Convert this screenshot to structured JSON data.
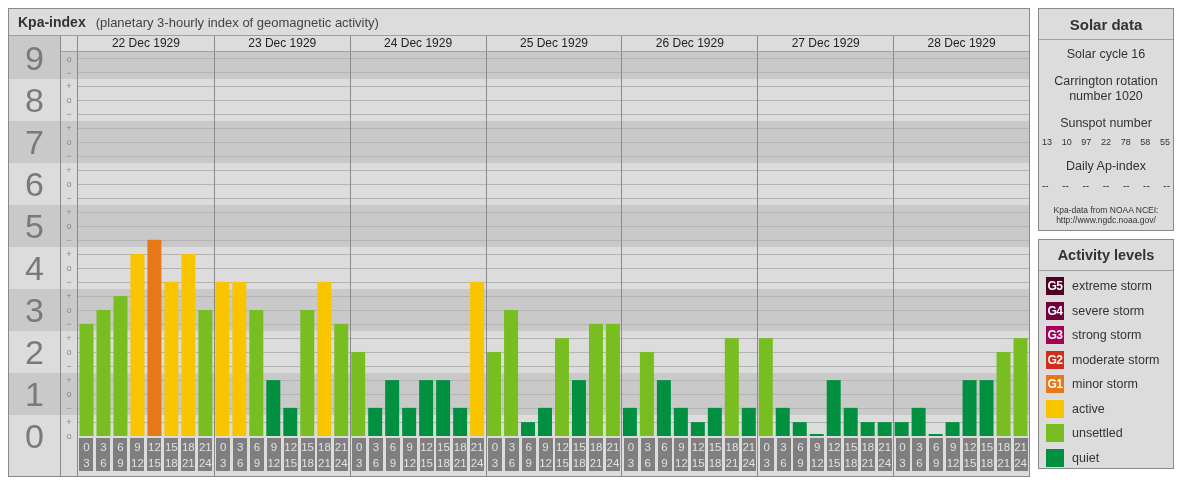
{
  "kp_chart": {
    "title": "Kpa-index",
    "subtitle": "(planetary 3-hourly index of geomagnetic activity)",
    "dates": [
      "22 Dec 1929",
      "23 Dec 1929",
      "24 Dec 1929",
      "25 Dec 1929",
      "26 Dec 1929",
      "27 Dec 1929",
      "28 Dec 1929"
    ],
    "minor_ticks": [
      "o",
      "−",
      "+",
      "o",
      "−",
      "+",
      "o",
      "−",
      "+",
      "o",
      "−",
      "+",
      "o",
      "−",
      "+",
      "o",
      "−",
      "+",
      "o",
      "−",
      "+",
      "o",
      "−",
      "+",
      "o",
      "−",
      "+",
      "o"
    ],
    "chart_data": {
      "type": "bar",
      "grid": true,
      "categories": [
        "0 3",
        "3 6",
        "6 9",
        "9 12",
        "12 15",
        "15 18",
        "18 21",
        "21 24",
        "0 3",
        "3 6",
        "6 9",
        "9 12",
        "12 15",
        "15 18",
        "18 21",
        "21 24",
        "0 3",
        "3 6",
        "6 9",
        "9 12",
        "12 15",
        "15 18",
        "18 21",
        "21 24",
        "0 3",
        "3 6",
        "6 9",
        "9 12",
        "12 15",
        "15 18",
        "18 21",
        "21 24",
        "0 3",
        "3 6",
        "6 9",
        "9 12",
        "12 15",
        "15 18",
        "18 21",
        "21 24",
        "0 3",
        "3 6",
        "6 9",
        "9 12",
        "12 15",
        "15 18",
        "18 21",
        "21 24",
        "0 3",
        "3 6",
        "6 9",
        "9 12",
        "12 15",
        "15 18",
        "18 21",
        "21 24"
      ],
      "ylim": [
        0,
        9.14
      ],
      "yticks": [
        0,
        1,
        2,
        3,
        4,
        5,
        6,
        7,
        8,
        9
      ],
      "series": [
        {
          "color": "#009040",
          "values": [
            null,
            null,
            null,
            null,
            null,
            null,
            null,
            null,
            null,
            null,
            null,
            1.33,
            0.67,
            null,
            null,
            null,
            null,
            0.67,
            1.33,
            0.67,
            1.33,
            1.33,
            0.67,
            null,
            null,
            null,
            0.33,
            0.67,
            null,
            1.33,
            null,
            null,
            0.67,
            null,
            1.33,
            0.67,
            0.33,
            0.67,
            null,
            0.67,
            null,
            0.67,
            0.33,
            0,
            1.33,
            0.67,
            0.33,
            0.33,
            0.33,
            0.67,
            0,
            0.33,
            1.33,
            1.33,
            null,
            null
          ]
        },
        {
          "color": "#78be21",
          "values": [
            2.67,
            3,
            3.33,
            null,
            null,
            null,
            null,
            3,
            null,
            null,
            3,
            null,
            null,
            3,
            null,
            2.67,
            2,
            null,
            null,
            null,
            null,
            null,
            null,
            null,
            2,
            3,
            null,
            null,
            2.33,
            null,
            2.67,
            2.67,
            null,
            2,
            null,
            null,
            null,
            null,
            2.33,
            null,
            2.33,
            null,
            null,
            null,
            null,
            null,
            null,
            null,
            null,
            null,
            null,
            null,
            null,
            null,
            2,
            2.33
          ]
        },
        {
          "color": "#f9c500",
          "values": [
            null,
            null,
            null,
            4.33,
            null,
            3.67,
            4.33,
            null,
            3.67,
            3.67,
            null,
            null,
            null,
            null,
            3.67,
            null,
            null,
            null,
            null,
            null,
            null,
            null,
            null,
            3.67,
            null,
            null,
            null,
            null,
            null,
            null,
            null,
            null,
            null,
            null,
            null,
            null,
            null,
            null,
            null,
            null,
            null,
            null,
            null,
            null,
            null,
            null,
            null,
            null,
            null,
            null,
            null,
            null,
            null,
            null,
            null,
            null
          ]
        },
        {
          "color": "#e67817",
          "values": [
            null,
            null,
            null,
            null,
            4.67,
            null,
            null,
            null,
            null,
            null,
            null,
            null,
            null,
            null,
            null,
            null,
            null,
            null,
            null,
            null,
            null,
            null,
            null,
            null,
            null,
            null,
            null,
            null,
            null,
            null,
            null,
            null,
            null,
            null,
            null,
            null,
            null,
            null,
            null,
            null,
            null,
            null,
            null,
            null,
            null,
            null,
            null,
            null,
            null,
            null,
            null,
            null,
            null,
            null,
            null,
            null
          ]
        }
      ]
    }
  },
  "solar_data": {
    "title": "Solar data",
    "solar_cycle": "Solar cycle 16",
    "carrington": "Carrington rotation number 1020",
    "sunspot_heading": "Sunspot number",
    "sunspot_values": [
      "13",
      "10",
      "97",
      "22",
      "78",
      "58",
      "55"
    ],
    "ap_heading": "Daily Ap-index",
    "ap_values": [
      "--",
      "--",
      "--",
      "--",
      "--",
      "--",
      "--"
    ],
    "source_note": "Kpa-data from NOAA NCEI:",
    "source_link": "http://www.ngdc.noaa.gov/"
  },
  "legend": {
    "title": "Activity levels",
    "items": [
      {
        "badge": "G5",
        "label": "extreme storm",
        "color": "#4c0024"
      },
      {
        "badge": "G4",
        "label": "severe storm",
        "color": "#70003c"
      },
      {
        "badge": "G3",
        "label": "strong storm",
        "color": "#a50057"
      },
      {
        "badge": "G2",
        "label": "moderate storm",
        "color": "#d22d1a"
      },
      {
        "badge": "G1",
        "label": "minor storm",
        "color": "#e67817"
      },
      {
        "label": "active",
        "color": "#f9c500"
      },
      {
        "label": "unsettled",
        "color": "#78be21"
      },
      {
        "label": "quiet",
        "color": "#009040"
      }
    ]
  }
}
